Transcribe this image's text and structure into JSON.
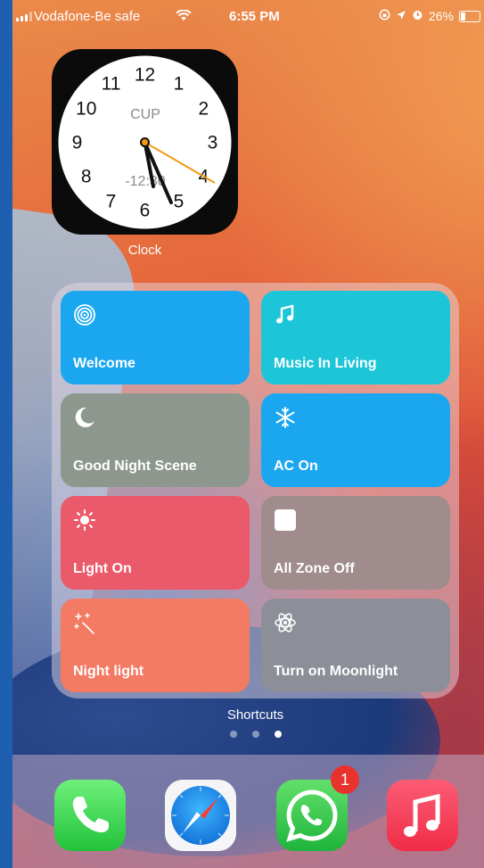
{
  "status_bar": {
    "carrier": "Vodafone-Be safe",
    "time": "6:55 PM",
    "battery": "26%"
  },
  "clock_widget": {
    "city": "CUP",
    "offset": "-12:30",
    "numbers": [
      "12",
      "1",
      "2",
      "3",
      "4",
      "5",
      "6",
      "7",
      "8",
      "9",
      "10",
      "11"
    ],
    "label": "Clock"
  },
  "shortcuts_widget": {
    "label": "Shortcuts",
    "tiles": [
      {
        "label": "Welcome",
        "icon": "concentric-circles-icon",
        "color": "#1aa7f0"
      },
      {
        "label": "Music In Living",
        "icon": "music-note-icon",
        "color": "#1cc6d8"
      },
      {
        "label": "Good Night Scene",
        "icon": "moon-icon",
        "color": "#8e978e"
      },
      {
        "label": "AC On",
        "icon": "snowflake-icon",
        "color": "#1aa7f0"
      },
      {
        "label": "Light On",
        "icon": "sun-icon",
        "color": "#ea5a6a"
      },
      {
        "label": "All Zone Off",
        "icon": "square-icon",
        "color": "#a08c8c"
      },
      {
        "label": "Night light",
        "icon": "sparkles-icon",
        "color": "#f37b63"
      },
      {
        "label": "Turn on Moonlight",
        "icon": "atom-icon",
        "color": "#8c8f98"
      }
    ]
  },
  "page_dots": {
    "count": 3,
    "active_index": 2
  },
  "dock": {
    "apps": [
      {
        "name": "Phone",
        "icon": "phone-icon"
      },
      {
        "name": "Safari",
        "icon": "compass-icon"
      },
      {
        "name": "WhatsApp",
        "icon": "whatsapp-icon",
        "badge": "1"
      },
      {
        "name": "Music",
        "icon": "music-note-icon"
      }
    ]
  }
}
